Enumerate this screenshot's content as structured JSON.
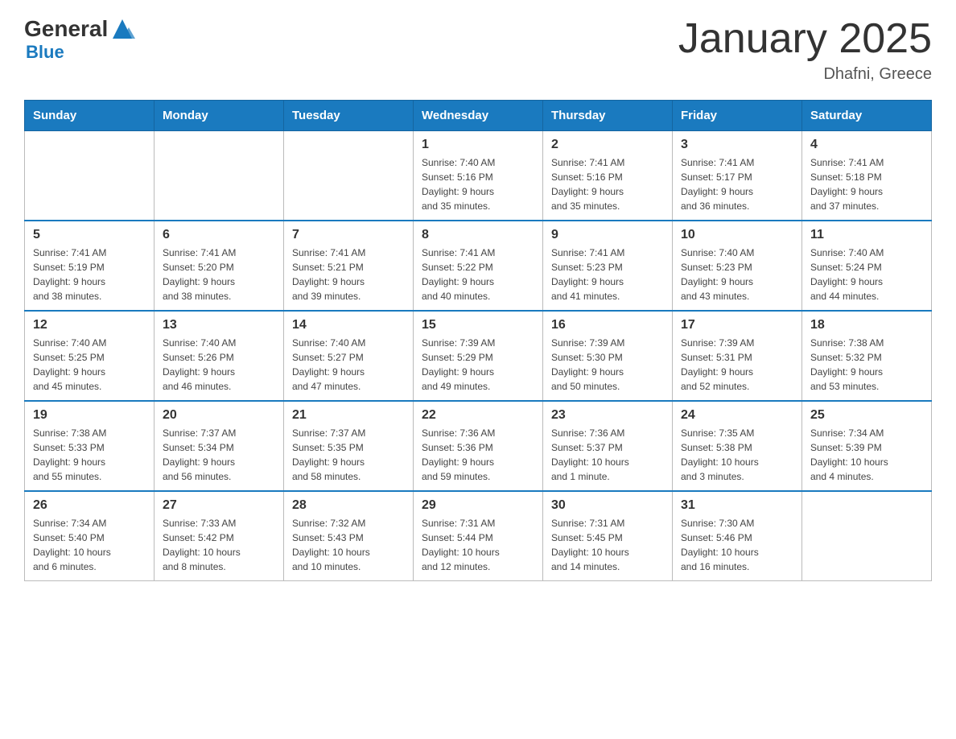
{
  "header": {
    "logo": {
      "general": "General",
      "blue": "Blue"
    },
    "title": "January 2025",
    "location": "Dhafni, Greece"
  },
  "calendar": {
    "headers": [
      "Sunday",
      "Monday",
      "Tuesday",
      "Wednesday",
      "Thursday",
      "Friday",
      "Saturday"
    ],
    "weeks": [
      [
        {
          "day": "",
          "info": ""
        },
        {
          "day": "",
          "info": ""
        },
        {
          "day": "",
          "info": ""
        },
        {
          "day": "1",
          "info": "Sunrise: 7:40 AM\nSunset: 5:16 PM\nDaylight: 9 hours\nand 35 minutes."
        },
        {
          "day": "2",
          "info": "Sunrise: 7:41 AM\nSunset: 5:16 PM\nDaylight: 9 hours\nand 35 minutes."
        },
        {
          "day": "3",
          "info": "Sunrise: 7:41 AM\nSunset: 5:17 PM\nDaylight: 9 hours\nand 36 minutes."
        },
        {
          "day": "4",
          "info": "Sunrise: 7:41 AM\nSunset: 5:18 PM\nDaylight: 9 hours\nand 37 minutes."
        }
      ],
      [
        {
          "day": "5",
          "info": "Sunrise: 7:41 AM\nSunset: 5:19 PM\nDaylight: 9 hours\nand 38 minutes."
        },
        {
          "day": "6",
          "info": "Sunrise: 7:41 AM\nSunset: 5:20 PM\nDaylight: 9 hours\nand 38 minutes."
        },
        {
          "day": "7",
          "info": "Sunrise: 7:41 AM\nSunset: 5:21 PM\nDaylight: 9 hours\nand 39 minutes."
        },
        {
          "day": "8",
          "info": "Sunrise: 7:41 AM\nSunset: 5:22 PM\nDaylight: 9 hours\nand 40 minutes."
        },
        {
          "day": "9",
          "info": "Sunrise: 7:41 AM\nSunset: 5:23 PM\nDaylight: 9 hours\nand 41 minutes."
        },
        {
          "day": "10",
          "info": "Sunrise: 7:40 AM\nSunset: 5:23 PM\nDaylight: 9 hours\nand 43 minutes."
        },
        {
          "day": "11",
          "info": "Sunrise: 7:40 AM\nSunset: 5:24 PM\nDaylight: 9 hours\nand 44 minutes."
        }
      ],
      [
        {
          "day": "12",
          "info": "Sunrise: 7:40 AM\nSunset: 5:25 PM\nDaylight: 9 hours\nand 45 minutes."
        },
        {
          "day": "13",
          "info": "Sunrise: 7:40 AM\nSunset: 5:26 PM\nDaylight: 9 hours\nand 46 minutes."
        },
        {
          "day": "14",
          "info": "Sunrise: 7:40 AM\nSunset: 5:27 PM\nDaylight: 9 hours\nand 47 minutes."
        },
        {
          "day": "15",
          "info": "Sunrise: 7:39 AM\nSunset: 5:29 PM\nDaylight: 9 hours\nand 49 minutes."
        },
        {
          "day": "16",
          "info": "Sunrise: 7:39 AM\nSunset: 5:30 PM\nDaylight: 9 hours\nand 50 minutes."
        },
        {
          "day": "17",
          "info": "Sunrise: 7:39 AM\nSunset: 5:31 PM\nDaylight: 9 hours\nand 52 minutes."
        },
        {
          "day": "18",
          "info": "Sunrise: 7:38 AM\nSunset: 5:32 PM\nDaylight: 9 hours\nand 53 minutes."
        }
      ],
      [
        {
          "day": "19",
          "info": "Sunrise: 7:38 AM\nSunset: 5:33 PM\nDaylight: 9 hours\nand 55 minutes."
        },
        {
          "day": "20",
          "info": "Sunrise: 7:37 AM\nSunset: 5:34 PM\nDaylight: 9 hours\nand 56 minutes."
        },
        {
          "day": "21",
          "info": "Sunrise: 7:37 AM\nSunset: 5:35 PM\nDaylight: 9 hours\nand 58 minutes."
        },
        {
          "day": "22",
          "info": "Sunrise: 7:36 AM\nSunset: 5:36 PM\nDaylight: 9 hours\nand 59 minutes."
        },
        {
          "day": "23",
          "info": "Sunrise: 7:36 AM\nSunset: 5:37 PM\nDaylight: 10 hours\nand 1 minute."
        },
        {
          "day": "24",
          "info": "Sunrise: 7:35 AM\nSunset: 5:38 PM\nDaylight: 10 hours\nand 3 minutes."
        },
        {
          "day": "25",
          "info": "Sunrise: 7:34 AM\nSunset: 5:39 PM\nDaylight: 10 hours\nand 4 minutes."
        }
      ],
      [
        {
          "day": "26",
          "info": "Sunrise: 7:34 AM\nSunset: 5:40 PM\nDaylight: 10 hours\nand 6 minutes."
        },
        {
          "day": "27",
          "info": "Sunrise: 7:33 AM\nSunset: 5:42 PM\nDaylight: 10 hours\nand 8 minutes."
        },
        {
          "day": "28",
          "info": "Sunrise: 7:32 AM\nSunset: 5:43 PM\nDaylight: 10 hours\nand 10 minutes."
        },
        {
          "day": "29",
          "info": "Sunrise: 7:31 AM\nSunset: 5:44 PM\nDaylight: 10 hours\nand 12 minutes."
        },
        {
          "day": "30",
          "info": "Sunrise: 7:31 AM\nSunset: 5:45 PM\nDaylight: 10 hours\nand 14 minutes."
        },
        {
          "day": "31",
          "info": "Sunrise: 7:30 AM\nSunset: 5:46 PM\nDaylight: 10 hours\nand 16 minutes."
        },
        {
          "day": "",
          "info": ""
        }
      ]
    ]
  }
}
